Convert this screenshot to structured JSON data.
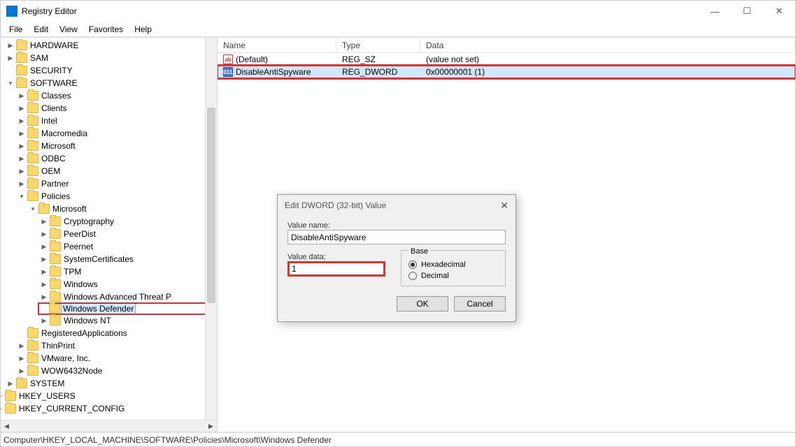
{
  "window": {
    "title": "Registry Editor"
  },
  "menu": {
    "file": "File",
    "edit": "Edit",
    "view": "View",
    "favorites": "Favorites",
    "help": "Help"
  },
  "tree": {
    "hardware": "HARDWARE",
    "sam": "SAM",
    "security": "SECURITY",
    "software": "SOFTWARE",
    "classes": "Classes",
    "clients": "Clients",
    "intel": "Intel",
    "macromedia": "Macromedia",
    "microsoft": "Microsoft",
    "odbc": "ODBC",
    "oem": "OEM",
    "partner": "Partner",
    "policies": "Policies",
    "pol_microsoft": "Microsoft",
    "cryptography": "Cryptography",
    "peerdist": "PeerDist",
    "peernet": "Peernet",
    "systemcertificates": "SystemCertificates",
    "tpm": "TPM",
    "windows": "Windows",
    "watp": "Windows Advanced Threat P",
    "windowsdefender": "Windows Defender",
    "windowsnt": "Windows NT",
    "registeredapplications": "RegisteredApplications",
    "thinprint": "ThinPrint",
    "vmware": "VMware, Inc.",
    "wow6432": "WOW6432Node",
    "system": "SYSTEM",
    "hkey_users": "HKEY_USERS",
    "hkey_current_config": "HKEY_CURRENT_CONFIG"
  },
  "list": {
    "headers": {
      "name": "Name",
      "type": "Type",
      "data": "Data"
    },
    "rows": [
      {
        "icon": "sz",
        "name": "(Default)",
        "type": "REG_SZ",
        "data": "(value not set)"
      },
      {
        "icon": "dw",
        "name": "DisableAntiSpyware",
        "type": "REG_DWORD",
        "data": "0x00000001 (1)"
      }
    ]
  },
  "dialog": {
    "title": "Edit DWORD (32-bit) Value",
    "value_name_label": "Value name:",
    "value_name": "DisableAntiSpyware",
    "value_data_label": "Value data:",
    "value_data": "1",
    "base_label": "Base",
    "hex_label": "Hexadecimal",
    "dec_label": "Decimal",
    "ok": "OK",
    "cancel": "Cancel"
  },
  "statusbar": {
    "path": "Computer\\HKEY_LOCAL_MACHINE\\SOFTWARE\\Policies\\Microsoft\\Windows Defender"
  }
}
